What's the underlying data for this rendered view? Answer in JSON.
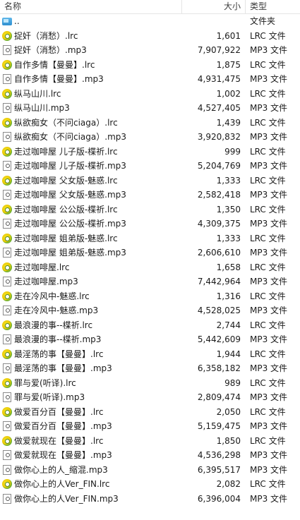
{
  "header": {
    "name": "名称",
    "size": "大小",
    "type": "类型"
  },
  "parent": {
    "name": "..",
    "type": "文件夹"
  },
  "files": [
    {
      "name": "捉奸（消愁）.lrc",
      "size": "1,601",
      "type": "LRC 文件",
      "icon": "lrc"
    },
    {
      "name": "捉奸（消愁）.mp3",
      "size": "7,907,922",
      "type": "MP3 文件",
      "icon": "mp3"
    },
    {
      "name": "自作多情【曼曼】.lrc",
      "size": "1,875",
      "type": "LRC 文件",
      "icon": "lrc"
    },
    {
      "name": "自作多情【曼曼】.mp3",
      "size": "4,931,475",
      "type": "MP3 文件",
      "icon": "mp3"
    },
    {
      "name": "纵马山川.lrc",
      "size": "1,002",
      "type": "LRC 文件",
      "icon": "lrc"
    },
    {
      "name": "纵马山川.mp3",
      "size": "4,527,405",
      "type": "MP3 文件",
      "icon": "mp3"
    },
    {
      "name": "纵欲痴女（不问ciaga）.lrc",
      "size": "1,439",
      "type": "LRC 文件",
      "icon": "lrc"
    },
    {
      "name": "纵欲痴女（不问ciaga）.mp3",
      "size": "3,920,832",
      "type": "MP3 文件",
      "icon": "mp3"
    },
    {
      "name": "走过咖啡屋 儿子版-楪祈.lrc",
      "size": "999",
      "type": "LRC 文件",
      "icon": "lrc"
    },
    {
      "name": "走过咖啡屋 儿子版-楪祈.mp3",
      "size": "5,204,769",
      "type": "MP3 文件",
      "icon": "mp3"
    },
    {
      "name": "走过咖啡屋 父女版-魅惑.lrc",
      "size": "1,333",
      "type": "LRC 文件",
      "icon": "lrc"
    },
    {
      "name": "走过咖啡屋 父女版-魅惑.mp3",
      "size": "2,582,418",
      "type": "MP3 文件",
      "icon": "mp3"
    },
    {
      "name": "走过咖啡屋 公公版-楪祈.lrc",
      "size": "1,350",
      "type": "LRC 文件",
      "icon": "lrc"
    },
    {
      "name": "走过咖啡屋 公公版-楪祈.mp3",
      "size": "4,309,375",
      "type": "MP3 文件",
      "icon": "mp3"
    },
    {
      "name": "走过咖啡屋 姐弟版-魅惑.lrc",
      "size": "1,333",
      "type": "LRC 文件",
      "icon": "lrc"
    },
    {
      "name": "走过咖啡屋 姐弟版-魅惑.mp3",
      "size": "2,606,610",
      "type": "MP3 文件",
      "icon": "mp3"
    },
    {
      "name": "走过咖啡屋.lrc",
      "size": "1,658",
      "type": "LRC 文件",
      "icon": "lrc"
    },
    {
      "name": "走过咖啡屋.mp3",
      "size": "7,442,964",
      "type": "MP3 文件",
      "icon": "mp3"
    },
    {
      "name": "走在冷风中-魅惑.lrc",
      "size": "1,316",
      "type": "LRC 文件",
      "icon": "lrc"
    },
    {
      "name": "走在冷风中-魅惑.mp3",
      "size": "4,528,025",
      "type": "MP3 文件",
      "icon": "mp3"
    },
    {
      "name": "最浪漫的事--楪祈.lrc",
      "size": "2,744",
      "type": "LRC 文件",
      "icon": "lrc"
    },
    {
      "name": "最浪漫的事--楪祈.mp3",
      "size": "5,442,609",
      "type": "MP3 文件",
      "icon": "mp3"
    },
    {
      "name": "最淫荡的事【曼曼】.lrc",
      "size": "1,944",
      "type": "LRC 文件",
      "icon": "lrc"
    },
    {
      "name": "最淫荡的事【曼曼】.mp3",
      "size": "6,358,182",
      "type": "MP3 文件",
      "icon": "mp3"
    },
    {
      "name": "罪与爱(听译).lrc",
      "size": "989",
      "type": "LRC 文件",
      "icon": "lrc"
    },
    {
      "name": "罪与爱(听译).mp3",
      "size": "2,809,474",
      "type": "MP3 文件",
      "icon": "mp3"
    },
    {
      "name": "做爱百分百【曼曼】.lrc",
      "size": "2,050",
      "type": "LRC 文件",
      "icon": "lrc"
    },
    {
      "name": "做爱百分百【曼曼】.mp3",
      "size": "5,159,475",
      "type": "MP3 文件",
      "icon": "mp3"
    },
    {
      "name": "做爱就现在【曼曼】.lrc",
      "size": "1,850",
      "type": "LRC 文件",
      "icon": "lrc"
    },
    {
      "name": "做爱就现在【曼曼】.mp3",
      "size": "4,536,298",
      "type": "MP3 文件",
      "icon": "mp3"
    },
    {
      "name": "做你心上的人_缩混.mp3",
      "size": "6,395,517",
      "type": "MP3 文件",
      "icon": "mp3"
    },
    {
      "name": "做你心上的人Ver_FIN.lrc",
      "size": "2,082",
      "type": "LRC 文件",
      "icon": "lrc"
    },
    {
      "name": "做你心上的人Ver_FIN.mp3",
      "size": "6,396,004",
      "type": "MP3 文件",
      "icon": "mp3"
    }
  ]
}
